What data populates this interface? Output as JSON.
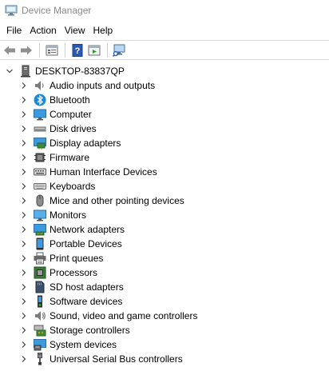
{
  "window": {
    "title": "Device Manager"
  },
  "menu": {
    "items": [
      "File",
      "Action",
      "View",
      "Help"
    ]
  },
  "toolbar": {
    "buttons": [
      "back-icon",
      "forward-icon",
      "properties-icon",
      "help-icon",
      "run-icon",
      "scan-hardware-icon"
    ]
  },
  "tree": {
    "root": {
      "label": "DESKTOP-83837QP",
      "icon": "computer-tower-icon"
    },
    "categories": [
      {
        "label": "Audio inputs and outputs",
        "icon": "speaker-icon"
      },
      {
        "label": "Bluetooth",
        "icon": "bluetooth-icon"
      },
      {
        "label": "Computer",
        "icon": "computer-monitor-icon"
      },
      {
        "label": "Disk drives",
        "icon": "disk-drive-icon"
      },
      {
        "label": "Display adapters",
        "icon": "display-adapter-icon"
      },
      {
        "label": "Firmware",
        "icon": "firmware-icon"
      },
      {
        "label": "Human Interface Devices",
        "icon": "hid-icon"
      },
      {
        "label": "Keyboards",
        "icon": "keyboard-icon"
      },
      {
        "label": "Mice and other pointing devices",
        "icon": "mouse-icon"
      },
      {
        "label": "Monitors",
        "icon": "monitor-icon"
      },
      {
        "label": "Network adapters",
        "icon": "network-adapter-icon"
      },
      {
        "label": "Portable Devices",
        "icon": "portable-device-icon"
      },
      {
        "label": "Print queues",
        "icon": "printer-icon"
      },
      {
        "label": "Processors",
        "icon": "processor-icon"
      },
      {
        "label": "SD host adapters",
        "icon": "sd-card-icon"
      },
      {
        "label": "Software devices",
        "icon": "software-device-icon"
      },
      {
        "label": "Sound, video and game controllers",
        "icon": "sound-controller-icon"
      },
      {
        "label": "Storage controllers",
        "icon": "storage-controller-icon"
      },
      {
        "label": "System devices",
        "icon": "system-devices-icon"
      },
      {
        "label": "Universal Serial Bus controllers",
        "icon": "usb-icon"
      }
    ]
  },
  "colors": {
    "title_text": "#8a8a8a",
    "icon_blue": "#1e88d8",
    "icon_dark": "#3a3a3a"
  }
}
